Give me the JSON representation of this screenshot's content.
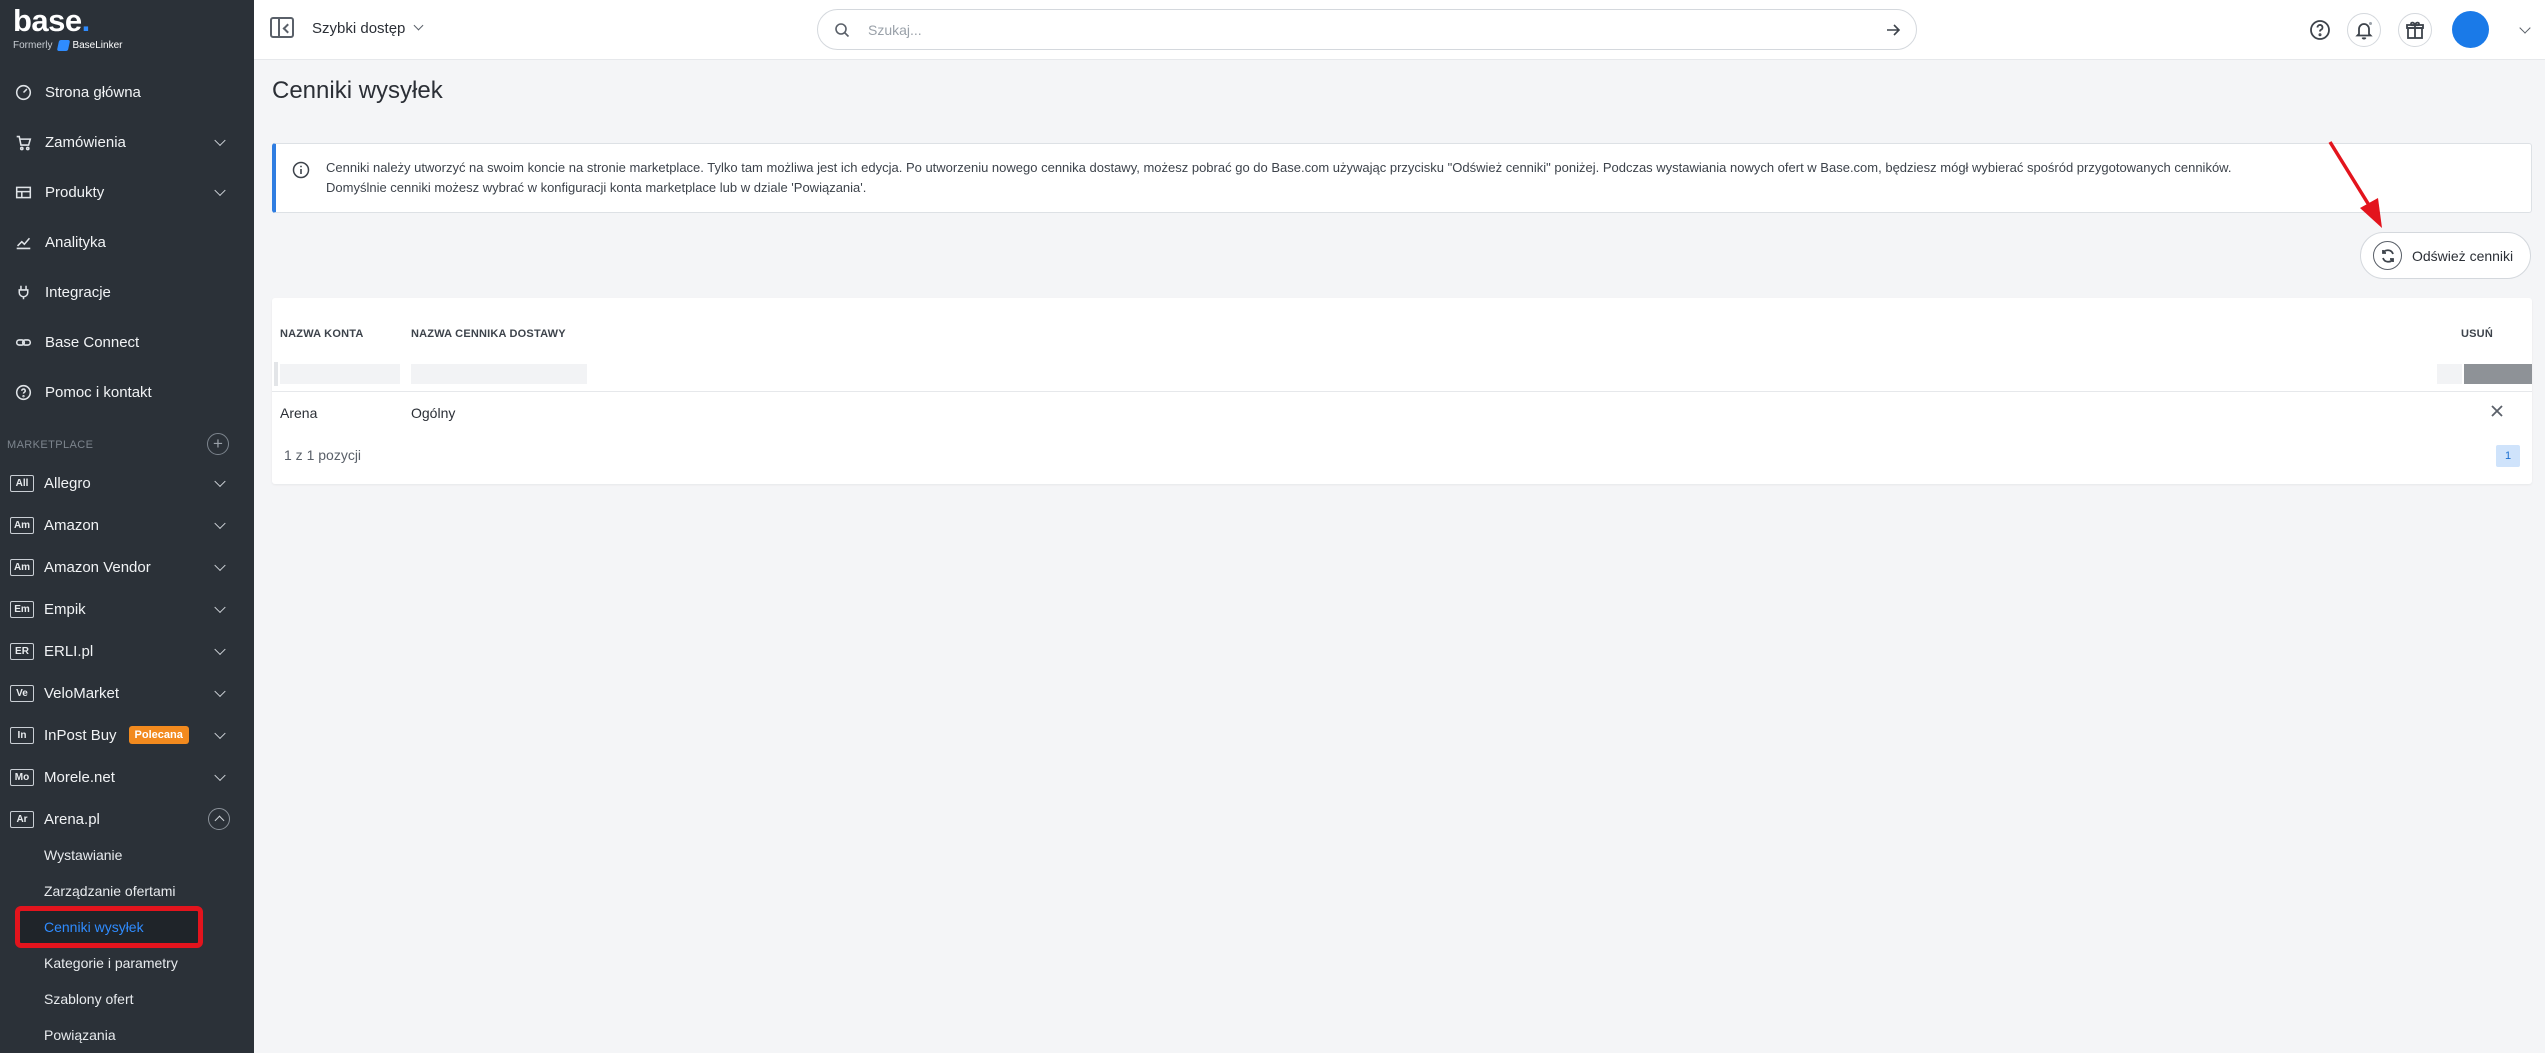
{
  "brand": {
    "name": "base",
    "formerly": "Formerly",
    "old_name": "BaseLinker"
  },
  "sidebar": {
    "items": [
      {
        "label": "Strona główna",
        "icon": "dashboard-icon"
      },
      {
        "label": "Zamówienia",
        "icon": "cart-icon"
      },
      {
        "label": "Produkty",
        "icon": "products-icon"
      },
      {
        "label": "Analityka",
        "icon": "analytics-icon"
      },
      {
        "label": "Integracje",
        "icon": "plug-icon"
      },
      {
        "label": "Base Connect",
        "icon": "link-icon"
      },
      {
        "label": "Pomoc i kontakt",
        "icon": "help-icon"
      }
    ],
    "section_label": "MARKETPLACE",
    "marketplaces": [
      {
        "badge": "All",
        "label": "Allegro"
      },
      {
        "badge": "Am",
        "label": "Amazon"
      },
      {
        "badge": "Am",
        "label": "Amazon Vendor"
      },
      {
        "badge": "Em",
        "label": "Empik"
      },
      {
        "badge": "ER",
        "label": "ERLI.pl"
      },
      {
        "badge": "Ve",
        "label": "VeloMarket"
      },
      {
        "badge": "In",
        "label": "InPost Buy",
        "tag": "Polecana"
      },
      {
        "badge": "Mo",
        "label": "Morele.net"
      },
      {
        "badge": "Ar",
        "label": "Arena.pl"
      }
    ],
    "arena_sub": [
      {
        "label": "Wystawianie"
      },
      {
        "label": "Zarządzanie ofertami"
      },
      {
        "label": "Cenniki wysyłek"
      },
      {
        "label": "Kategorie i parametry"
      },
      {
        "label": "Szablony ofert"
      },
      {
        "label": "Powiązania"
      }
    ]
  },
  "header": {
    "quick_access": "Szybki dostęp",
    "search_placeholder": "Szukaj..."
  },
  "main": {
    "title": "Cenniki wysyłek",
    "info_line1": "Cenniki należy utworzyć na swoim koncie na stronie marketplace. Tylko tam możliwa jest ich edycja. Po utworzeniu nowego cennika dostawy, możesz pobrać go do Base.com używając przycisku \"Odśwież cenniki\" poniżej. Podczas wystawiania nowych ofert w Base.com, będziesz mógł wybierać spośród przygotowanych cenników.",
    "info_line2": "Domyślnie cenniki możesz wybrać w konfiguracji konta marketplace lub w dziale 'Powiązania'.",
    "refresh_label": "Odśwież cenniki",
    "table": {
      "columns": [
        "NAZWA KONTA",
        "NAZWA CENNIKA DOSTAWY",
        "USUŃ"
      ],
      "rows": [
        {
          "account": "Arena",
          "pricelist": "Ogólny"
        }
      ],
      "pager_text": "1 z 1 pozycji",
      "page": "1"
    }
  },
  "colors": {
    "sidebar_bg": "#2b3138",
    "accent": "#1a7ae8",
    "highlight": "#e3141d",
    "tag": "#f28a1e"
  }
}
